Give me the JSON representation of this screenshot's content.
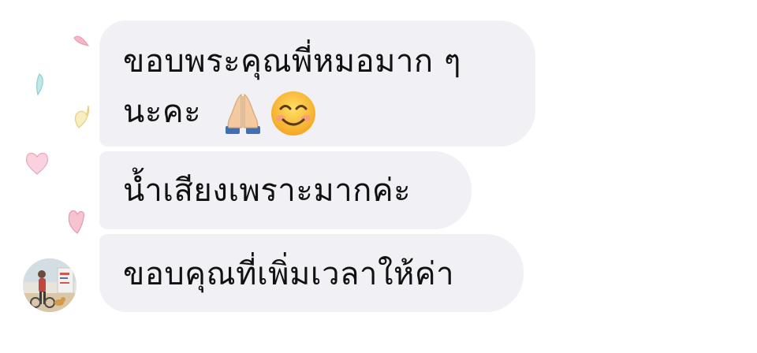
{
  "decorations": {
    "hearts": [
      "pink-heart",
      "teal-heart",
      "yellow-heart",
      "pink-heart",
      "pink-heart"
    ]
  },
  "sender": {
    "avatar_icon": "profile-photo"
  },
  "messages": [
    {
      "line1": "ขอบพระคุณพี่หมอมาก ๆ",
      "line2": "นะคะ",
      "emojis": [
        "folded-hands-icon",
        "smiling-face-icon"
      ]
    },
    {
      "text": "น้ำเสียงเพราะมากค่ะ"
    },
    {
      "text": "ขอบคุณที่เพิ่มเวลาให้ค่า"
    }
  ],
  "colors": {
    "bubble_bg": "#f0f0f5",
    "text": "#111111",
    "heart_pink": "#f4b6c8",
    "heart_teal": "#a8dde0",
    "heart_yellow": "#f5e3a0"
  }
}
